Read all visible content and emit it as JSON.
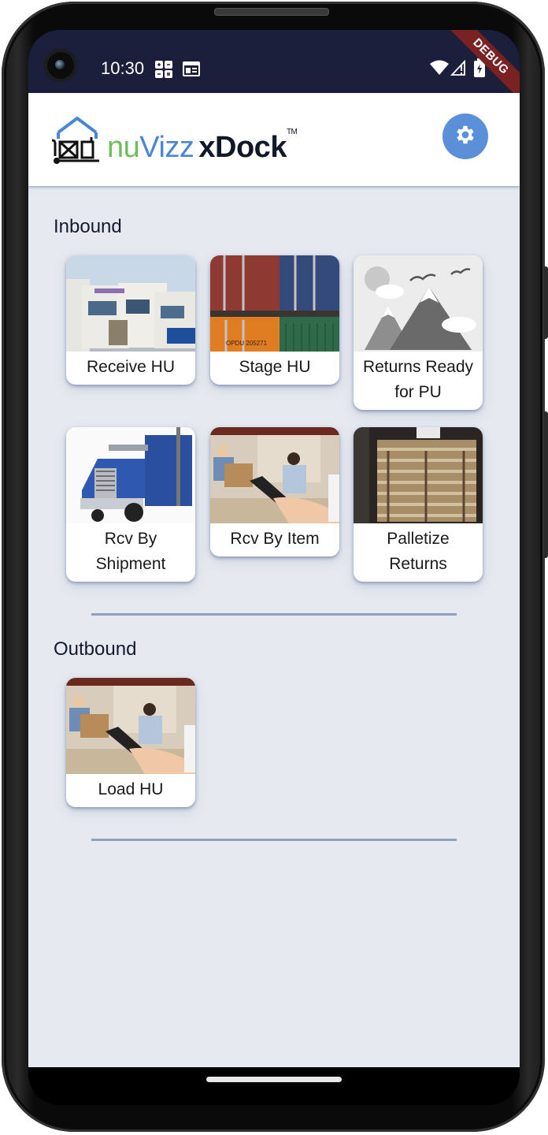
{
  "status_bar": {
    "time": "10:30",
    "notification_icons": [
      "calculator-icon",
      "calendar-icon"
    ],
    "system_icons": [
      "wifi-icon",
      "cell-signal-icon",
      "battery-charging-icon"
    ],
    "debug_banner": "DEBUG"
  },
  "app_bar": {
    "brand_nu": "nu",
    "brand_vizz": "Vizz",
    "brand_product": "xDock",
    "brand_tm": "TM",
    "settings_icon": "gear-icon"
  },
  "sections": [
    {
      "title": "Inbound",
      "tiles": [
        {
          "label": "Receive HU",
          "image": "trucks-photo"
        },
        {
          "label": "Stage HU",
          "image": "containers-photo"
        },
        {
          "label": "Returns Ready for PU",
          "image": "placeholder-landscape"
        },
        {
          "label": "Rcv By Shipment",
          "image": "blue-truck-photo"
        },
        {
          "label": "Rcv By Item",
          "image": "warehouse-tablet-photo"
        },
        {
          "label": "Palletize Returns",
          "image": "pallets-photo"
        }
      ]
    },
    {
      "title": "Outbound",
      "tiles": [
        {
          "label": "Load HU",
          "image": "warehouse-tablet-photo"
        }
      ]
    }
  ],
  "colors": {
    "status_bar": "#1b1f3b",
    "accent": "#5b8fd8",
    "brand_green": "#6cbf5a",
    "brand_blue": "#4a86d6",
    "background": "#e6e9ef",
    "divider": "#8fa1bd",
    "debug_banner": "#7a2222"
  }
}
